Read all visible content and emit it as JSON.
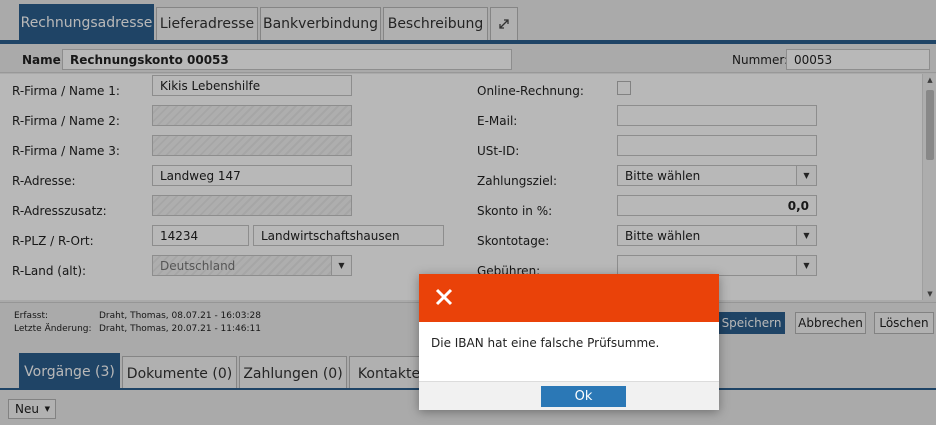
{
  "tabs": {
    "rechnungsadresse": "Rechnungsadresse",
    "lieferadresse": "Lieferadresse",
    "bankverbindung": "Bankverbindung",
    "beschreibung": "Beschreibung",
    "expand_icon": "expand-icon"
  },
  "header": {
    "name_label": "Name:",
    "name_value": "Rechnungskonto 00053",
    "nummer_label": "Nummer:",
    "nummer_value": "00053"
  },
  "form_left": {
    "firma1_label": "R-Firma / Name 1:",
    "firma1_value": "Kikis Lebenshilfe",
    "firma2_label": "R-Firma / Name 2:",
    "firma2_value": "",
    "firma3_label": "R-Firma / Name 3:",
    "firma3_value": "",
    "adresse_label": "R-Adresse:",
    "adresse_value": "Landweg 147",
    "zusatz_label": "R-Adresszusatz:",
    "zusatz_value": "",
    "plz_ort_label": "R-PLZ / R-Ort:",
    "plz_value": "14234",
    "ort_value": "Landwirtschaftshausen",
    "land_label": "R-Land (alt):",
    "land_value": "Deutschland"
  },
  "form_right": {
    "online_label": "Online-Rechnung:",
    "email_label": "E-Mail:",
    "email_value": "",
    "ustid_label": "USt-ID:",
    "ustid_value": "",
    "zahlungsziel_label": "Zahlungsziel:",
    "zahlungsziel_value": "Bitte wählen",
    "skonto_label": "Skonto in %:",
    "skonto_value": "0,0",
    "skontotage_label": "Skontotage:",
    "skontotage_value": "Bitte wählen",
    "gebuehren_label": "Gebühren:",
    "gebuehren_value": ""
  },
  "footer": {
    "erfasst_label": "Erfasst:",
    "erfasst_value": "Draht, Thomas, 08.07.21 - 16:03:28",
    "aenderung_label": "Letzte Änderung:",
    "aenderung_value": "Draht, Thomas, 20.07.21 - 11:46:11",
    "speichern": "Speichern",
    "abbrechen": "Abbrechen",
    "loeschen": "Löschen"
  },
  "bottom_tabs": {
    "vorgaenge": "Vorgänge (3)",
    "dokumente": "Dokumente (0)",
    "zahlungen": "Zahlungen (0)",
    "kontakte": "Kontakte"
  },
  "toolbar": {
    "neu": "Neu"
  },
  "dialog": {
    "message": "Die IBAN hat eine falsche Prüfsumme.",
    "ok": "Ok",
    "header_color": "#ea4209"
  }
}
